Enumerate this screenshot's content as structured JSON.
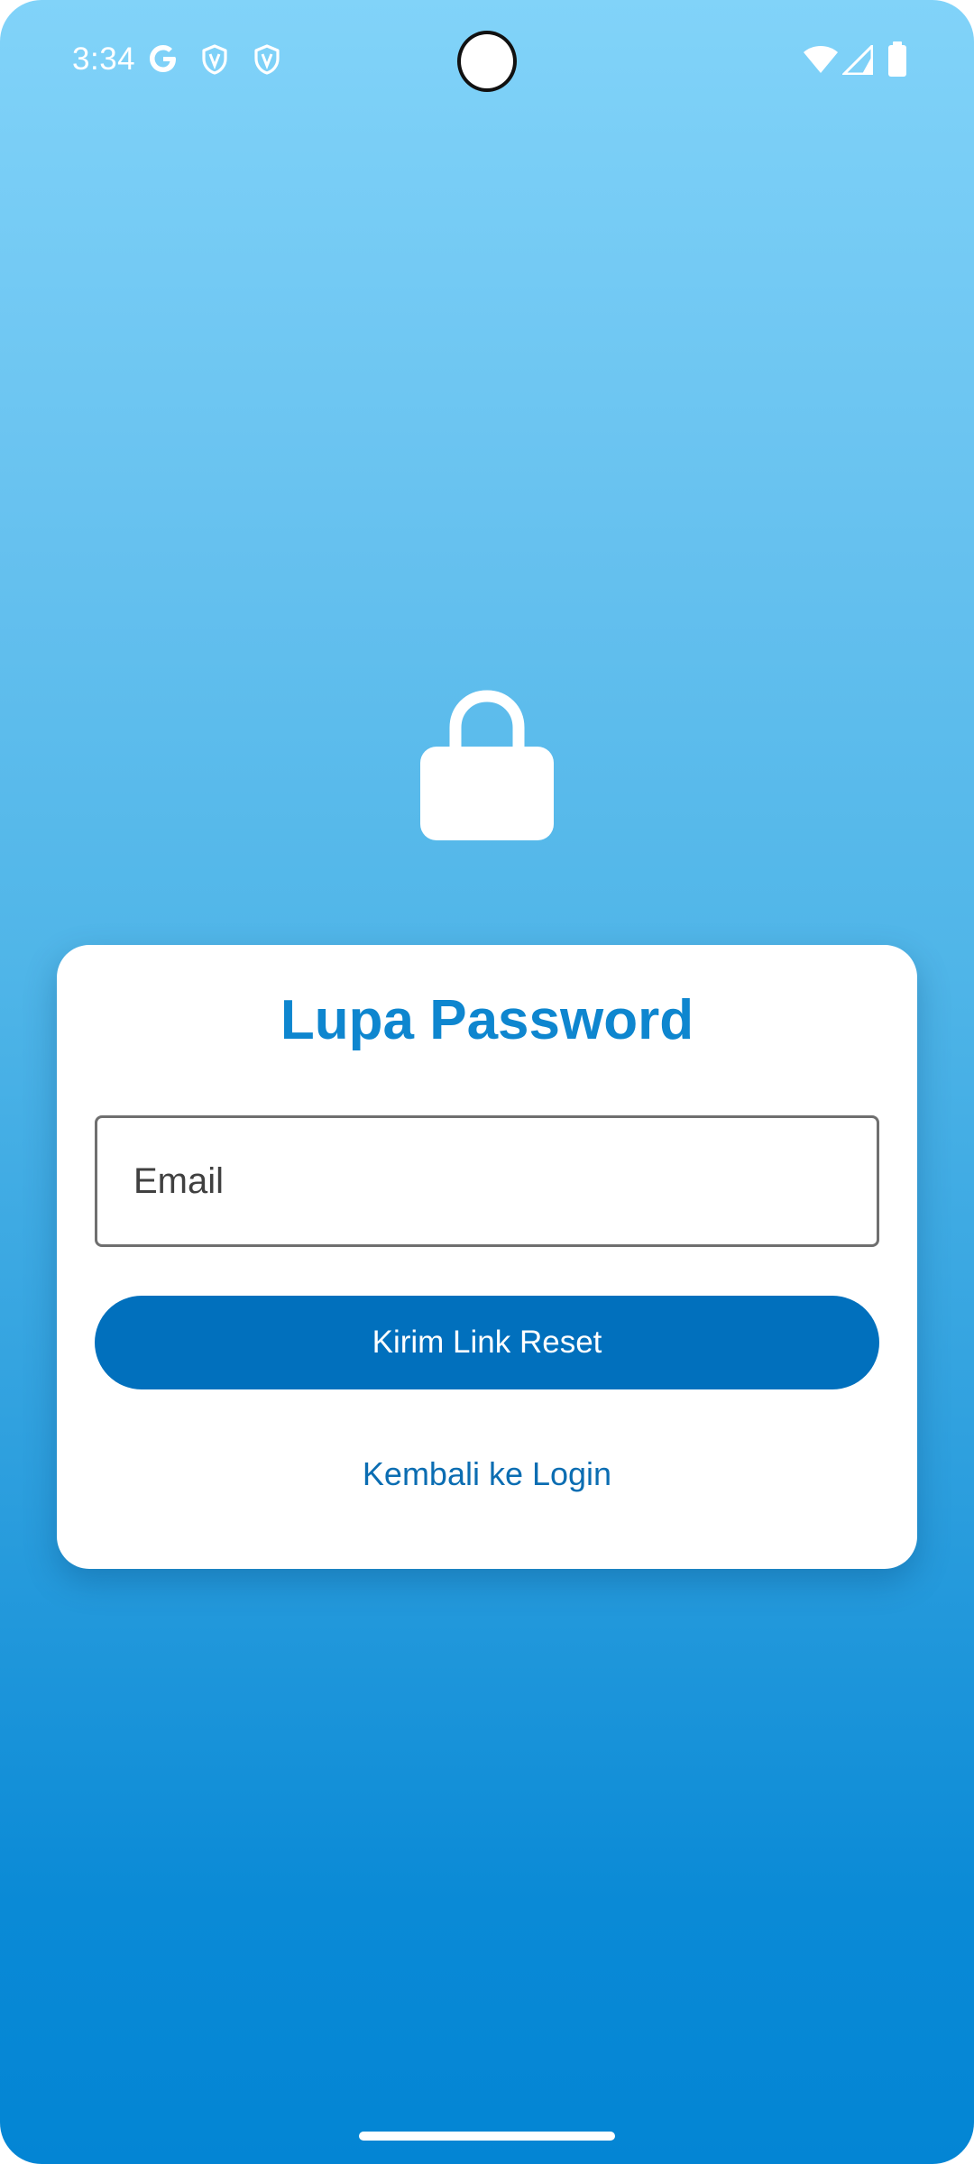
{
  "status_bar": {
    "time": "3:34",
    "left_icons": [
      "google-icon",
      "shield-icon",
      "shield-icon"
    ],
    "right_icons": [
      "wifi-icon",
      "signal-icon",
      "battery-icon"
    ]
  },
  "header": {
    "icon": "lock-icon"
  },
  "card": {
    "title": "Lupa Password",
    "email_placeholder": "Email",
    "email_value": "",
    "submit_label": "Kirim Link Reset",
    "back_link_label": "Kembali ke Login"
  },
  "colors": {
    "gradient_top": "#81d3f9",
    "gradient_bottom": "#0385d4",
    "title": "#0e86cf",
    "primary_button": "#0170bd",
    "link": "#0b6db2",
    "card_background": "#ffffff"
  }
}
